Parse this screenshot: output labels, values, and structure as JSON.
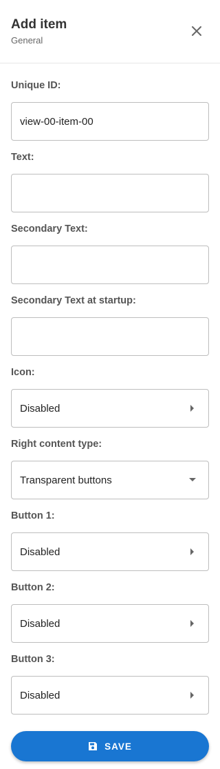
{
  "header": {
    "title": "Add item",
    "subtitle": "General",
    "close_icon": "close-icon"
  },
  "fields": {
    "unique_id": {
      "label": "Unique ID:",
      "value": "view-00-item-00"
    },
    "text": {
      "label": "Text:",
      "value": ""
    },
    "secondary_text": {
      "label": "Secondary Text:",
      "value": ""
    },
    "secondary_text_startup": {
      "label": "Secondary Text at startup:",
      "value": ""
    },
    "icon": {
      "label": "Icon:",
      "value": "Disabled",
      "indicator": "chevron-right-icon"
    },
    "right_content_type": {
      "label": "Right content type:",
      "value": "Transparent buttons",
      "indicator": "caret-down-icon"
    },
    "button1": {
      "label": "Button 1:",
      "value": "Disabled",
      "indicator": "chevron-right-icon"
    },
    "button2": {
      "label": "Button 2:",
      "value": "Disabled",
      "indicator": "chevron-right-icon"
    },
    "button3": {
      "label": "Button 3:",
      "value": "Disabled",
      "indicator": "chevron-right-icon"
    }
  },
  "save_button": {
    "label": "SAVE",
    "icon": "floppy-disk-icon"
  },
  "colors": {
    "accent": "#1976d2",
    "border": "#bdbdbd",
    "label": "#555555",
    "text": "#222222"
  }
}
